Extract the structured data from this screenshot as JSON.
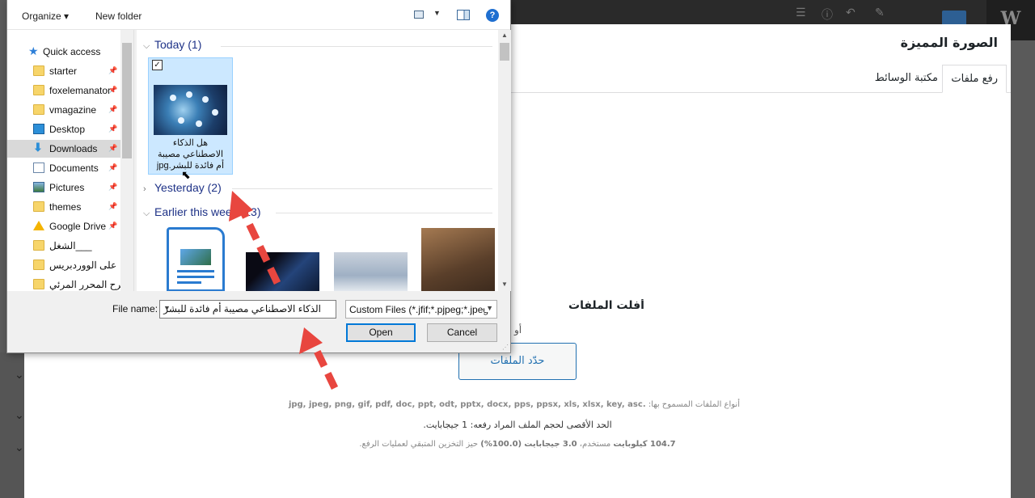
{
  "wp": {
    "modal_title": "الصورة المميزة",
    "tabs": [
      "رفع ملفات",
      "مكتبة الوسائط"
    ],
    "drop_title": "أفلت الملفات",
    "drop_or": "أو",
    "select_files_label": "حدّد الملفات",
    "allowed_label": "أنواع الملفات المسموح بها:",
    "allowed_types": ".jpg, jpeg, png, gif, pdf, doc, ppt, odt, pptx, docx, pps, ppsx, xls, xlsx, key, asc",
    "max_size": "الحد الأقصى لحجم الملف المراد رفعه: 1 جيجابايت.",
    "storage_used": "104.7 كيلوبايت",
    "storage_used_suffix": "مستخدم،",
    "storage_total": "3.0 جيجابايت",
    "storage_pct": "(100.0%)",
    "storage_suffix": "حيز التخزين المتبقي لعمليات الرفع.",
    "logo_text": "W"
  },
  "dialog": {
    "toolbar": {
      "organize": "Organize ▾",
      "new_folder": "New folder",
      "help": "?"
    },
    "nav": [
      {
        "label": "Quick access",
        "icon": "star-icon"
      },
      {
        "label": "starter",
        "icon": "folder-icon",
        "pinned": true
      },
      {
        "label": "foxelemanator",
        "icon": "folder-icon",
        "pinned": true
      },
      {
        "label": "vmagazine",
        "icon": "folder-icon",
        "pinned": true
      },
      {
        "label": "Desktop",
        "icon": "desktop-icon",
        "pinned": true
      },
      {
        "label": "Downloads",
        "icon": "downloads-icon",
        "pinned": true
      },
      {
        "label": "Documents",
        "icon": "documents-icon",
        "pinned": true
      },
      {
        "label": "Pictures",
        "icon": "pictures-icon",
        "pinned": true
      },
      {
        "label": "themes",
        "icon": "folder-icon",
        "pinned": true
      },
      {
        "label": "Google Drive",
        "icon": "google-drive-icon",
        "pinned": true
      },
      {
        "label": "الشغل___",
        "icon": "folder-icon"
      },
      {
        "label": "على الووردبريس",
        "icon": "folder-icon"
      },
      {
        "label": "شرح المحرر المرئي",
        "icon": "folder-icon"
      }
    ],
    "selected_nav": "Downloads",
    "groups": {
      "today": "Today (1)",
      "yesterday": "Yesterday (2)",
      "earlier": "Earlier this week (13)"
    },
    "selected_file": "هل الذكاء الاصطناعي مصيبة أم فائدة للبشر.jpg",
    "selected_file_lines": [
      "هل الذكاء",
      "الاصطناعي مصيبة",
      "أم فائدة للبشر.jpg"
    ],
    "filename_label": "File name:",
    "filename_value": "الذكاء الاصطناعي مصيبة أم فائدة للبشر",
    "filetype_value": "Custom Files (*.jfif;*.pjpeg;*.jpeg",
    "open_label": "Open",
    "cancel_label": "Cancel"
  },
  "colors": {
    "arrow": "#e8463f",
    "accent": "#2271b1",
    "selection": "#cce8ff"
  }
}
